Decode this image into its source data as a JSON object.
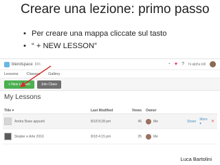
{
  "slide": {
    "title": "Creare una lezione: primo passo",
    "bullets": [
      "Per creare una mappa cliccate sul tasto",
      "“ + NEW LESSON”"
    ],
    "author": "Luca Bartolini"
  },
  "app": {
    "logo_text": "blendspace",
    "logo_sub": "tim",
    "header_icons": [
      "compass-icon",
      "heart-icon",
      "help-icon",
      "avatar"
    ],
    "user": "hi alpha bill",
    "tabs": [
      "Lessons",
      "Classes",
      "Gallery"
    ],
    "new_lesson_label": "+ New Lesson",
    "join_class_label": "Join Class",
    "lessons_heading": "My Lessons",
    "table": {
      "columns": [
        "Title ▾",
        "Last Modified",
        "Views",
        "Owner"
      ],
      "rows": [
        {
          "title": "Andra Base appunti",
          "modified": "8/18 8:28 pm",
          "views": "45",
          "owner": "Me",
          "share": "Share",
          "more": "More ▾"
        },
        {
          "title": "Skaber e Arte 2016",
          "modified": "8/18 4:15 pm",
          "views": "35",
          "owner": "Me",
          "share": "",
          "more": ""
        }
      ]
    },
    "colors": {
      "new_lesson": "#4caf50",
      "join_class": "#6f6f6f",
      "arrow": "#d0302a",
      "accent_link": "#4a90c2"
    }
  }
}
